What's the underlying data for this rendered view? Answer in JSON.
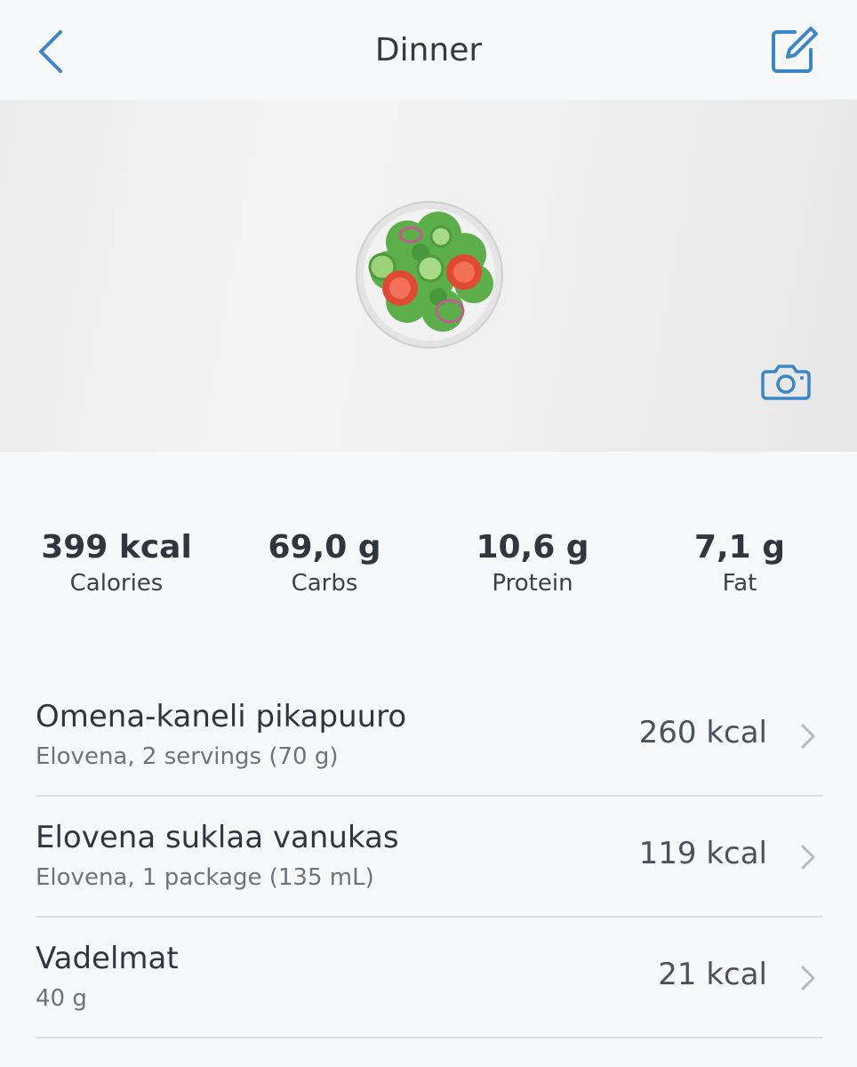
{
  "nav": {
    "title": "Dinner",
    "back_icon": "chevron-left-icon",
    "edit_icon": "edit-icon"
  },
  "photo": {
    "image": "green-salad-emoji",
    "camera_icon": "camera-icon"
  },
  "macros": [
    {
      "value": "399 kcal",
      "label": "Calories"
    },
    {
      "value": "69,0 g",
      "label": "Carbs"
    },
    {
      "value": "10,6 g",
      "label": "Protein"
    },
    {
      "value": "7,1 g",
      "label": "Fat"
    }
  ],
  "foods": [
    {
      "name": "Omena-kaneli pikapuuro",
      "detail": "Elovena, 2 servings (70 g)",
      "kcal": "260 kcal"
    },
    {
      "name": "Elovena suklaa vanukas",
      "detail": "Elovena, 1 package (135 mL)",
      "kcal": "119 kcal"
    },
    {
      "name": "Vadelmat",
      "detail": "40 g",
      "kcal": "21 kcal"
    }
  ],
  "colors": {
    "accent": "#3a86c8",
    "divider": "#dcdfe3",
    "background": "#f7f8fa"
  }
}
